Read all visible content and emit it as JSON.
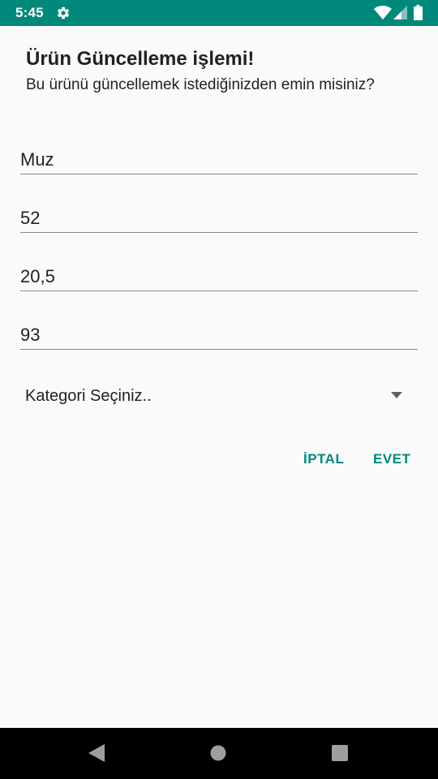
{
  "status_bar": {
    "time": "5:45",
    "icons": [
      "gear-icon",
      "wifi-icon",
      "signal-icon",
      "battery-icon"
    ],
    "color": "#00897b"
  },
  "dialog": {
    "title": "Ürün Güncelleme işlemi!",
    "message": "Bu ürünü güncellemek istediğinizden emin misiniz?",
    "fields": [
      {
        "value": "Muz"
      },
      {
        "value": "52"
      },
      {
        "value": "20,5"
      },
      {
        "value": "93"
      }
    ],
    "category_spinner": {
      "selected": "Kategori Seçiniz.."
    },
    "buttons": {
      "cancel": "İPTAL",
      "ok": "EVET"
    },
    "accent_color": "#00897b"
  },
  "nav_bar": {
    "icons": [
      "back-icon",
      "home-icon",
      "recents-icon"
    ]
  }
}
